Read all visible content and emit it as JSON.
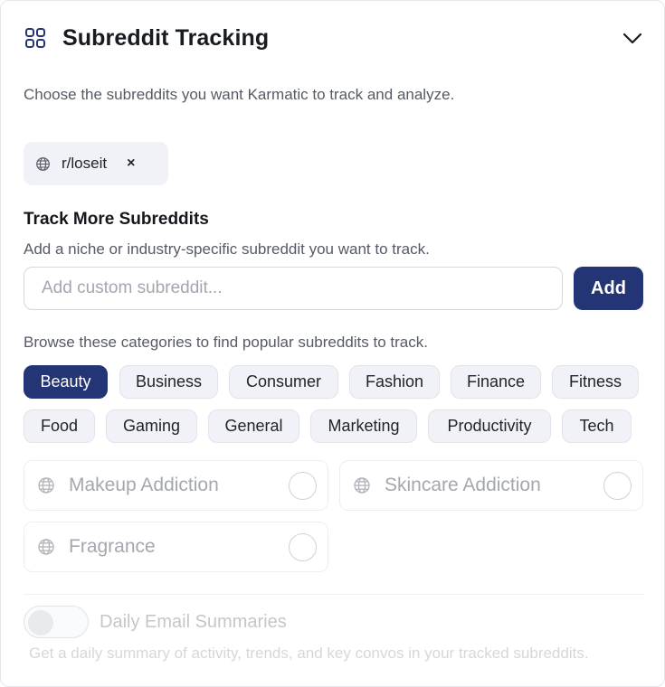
{
  "header": {
    "title": "Subreddit Tracking"
  },
  "intro": "Choose the subreddits you want Karmatic to track and analyze.",
  "selected": [
    {
      "label": "r/loseit",
      "remove": "×"
    }
  ],
  "track_more": {
    "title": "Track More Subreddits",
    "subtitle": "Add a niche or industry-specific subreddit you want to track.",
    "input_placeholder": "Add custom subreddit...",
    "input_value": "",
    "add_label": "Add"
  },
  "browse": {
    "text": "Browse these categories to find popular subreddits to track.",
    "categories": [
      "Beauty",
      "Business",
      "Consumer",
      "Fashion",
      "Finance",
      "Fitness",
      "Food",
      "Gaming",
      "General",
      "Marketing",
      "Productivity",
      "Tech"
    ],
    "active_category": "Beauty"
  },
  "subreddits": [
    "Makeup Addiction",
    "Skincare Addiction",
    "Fragrance"
  ],
  "email": {
    "label": "Daily Email Summaries",
    "description": "Get a daily summary of activity, trends, and key convos in your tracked subreddits."
  },
  "colors": {
    "accent": "#243575",
    "chip_bg": "#f1f2f7",
    "muted_text": "#555a66"
  },
  "icons": {
    "header": "grid-icon",
    "collapse": "chevron-down-icon",
    "subreddit": "globe-icon",
    "remove": "close-icon"
  }
}
